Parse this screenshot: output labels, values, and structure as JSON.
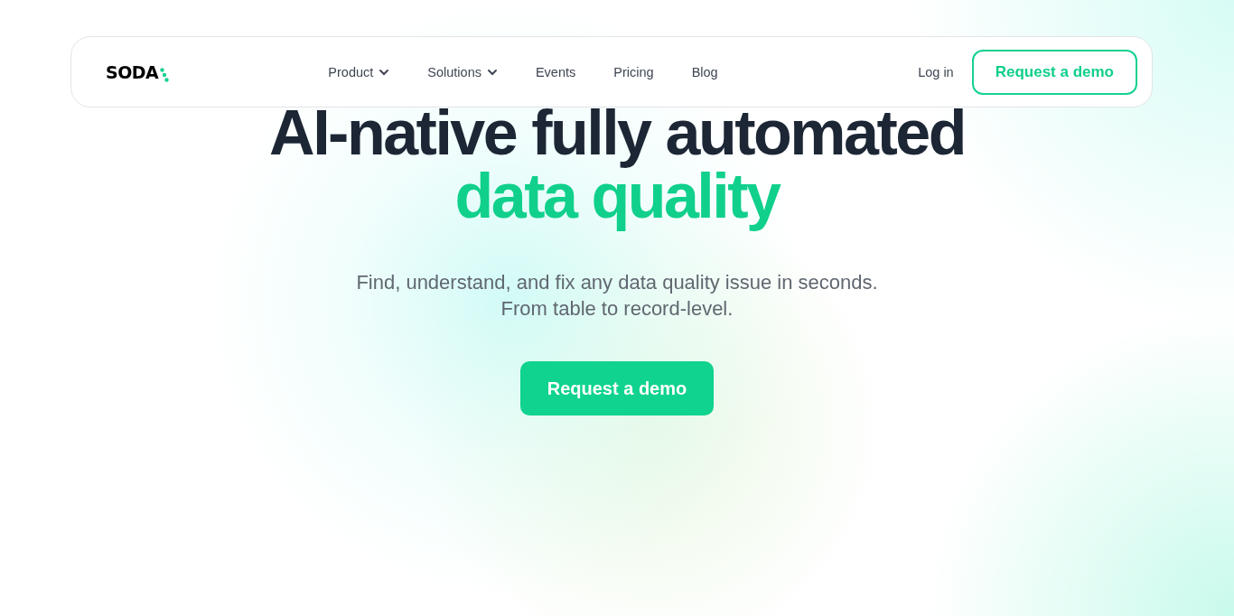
{
  "nav": {
    "logo": "SODA",
    "items": [
      {
        "label": "Product",
        "has_menu": true
      },
      {
        "label": "Solutions",
        "has_menu": true
      },
      {
        "label": "Events",
        "has_menu": false
      },
      {
        "label": "Pricing",
        "has_menu": false
      },
      {
        "label": "Blog",
        "has_menu": false
      }
    ],
    "login": "Log in",
    "cta": "Request a demo"
  },
  "hero": {
    "title": "AI-native fully automated",
    "title_highlight": "data quality",
    "subtitle": [
      "Find, understand, and fix any data quality issue in seconds.",
      "From table to record-level."
    ],
    "cta": "Request a demo"
  }
}
